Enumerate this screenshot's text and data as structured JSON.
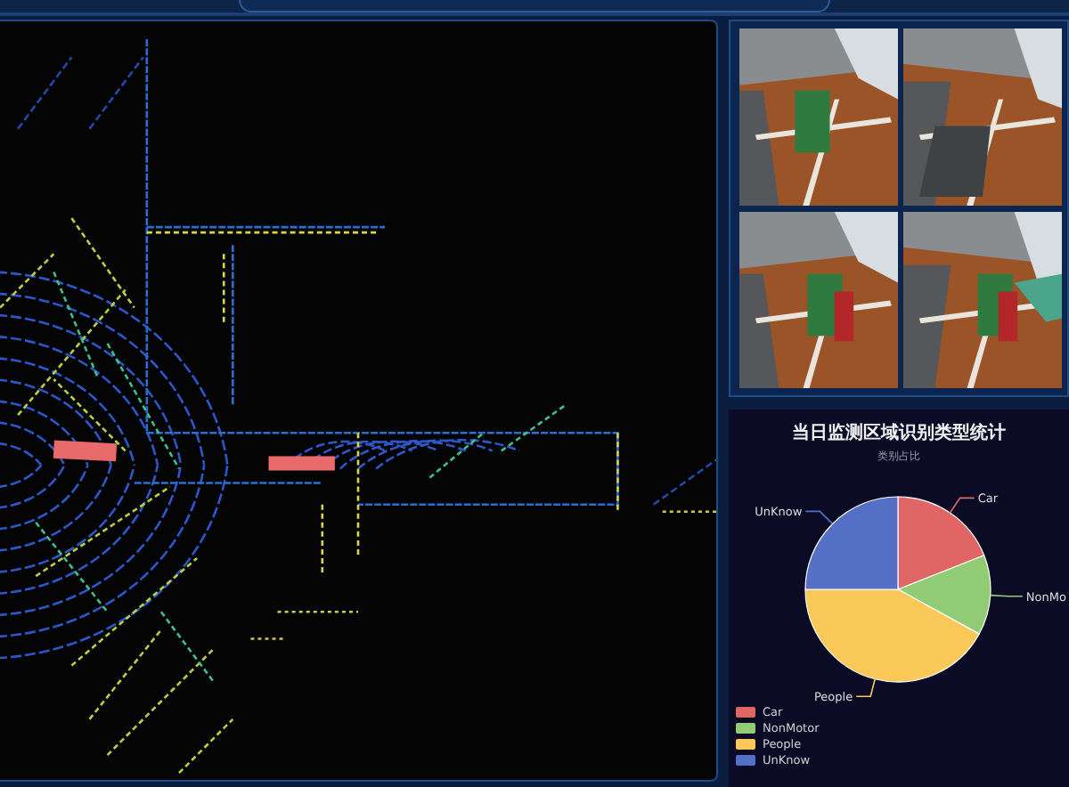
{
  "stats_panel": {
    "title": "当日监测区域识别类型统计",
    "subtitle": "类别占比",
    "slice_labels": [
      "Car",
      "NonMo",
      "People",
      "UnKnow"
    ],
    "chart_data": {
      "type": "pie",
      "categories": [
        "Car",
        "NonMotor",
        "People",
        "UnKnow"
      ],
      "values": [
        19,
        14,
        42,
        25
      ],
      "colors": [
        "#e06666",
        "#91cc75",
        "#fac858",
        "#5470c6"
      ]
    }
  }
}
